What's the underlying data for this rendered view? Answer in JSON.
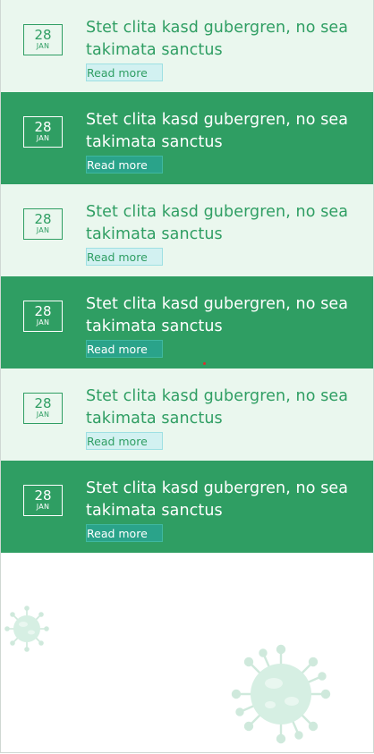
{
  "news": {
    "items": [
      {
        "day": "28",
        "month": "JAN",
        "title": "Stet clita kasd gubergren, no sea takimata sanctus",
        "link": "Read more"
      },
      {
        "day": "28",
        "month": "JAN",
        "title": "Stet clita kasd gubergren, no sea takimata sanctus",
        "link": "Read more"
      },
      {
        "day": "28",
        "month": "JAN",
        "title": "Stet clita kasd gubergren, no sea takimata sanctus",
        "link": "Read more"
      },
      {
        "day": "28",
        "month": "JAN",
        "title": "Stet clita kasd gubergren, no sea takimata sanctus",
        "link": "Read more"
      },
      {
        "day": "28",
        "month": "JAN",
        "title": "Stet clita kasd gubergren, no sea takimata sanctus",
        "link": "Read more"
      },
      {
        "day": "28",
        "month": "JAN",
        "title": "Stet clita kasd gubergren, no sea takimata sanctus",
        "link": "Read more"
      }
    ]
  },
  "decorations": {
    "icons": [
      "virus-icon",
      "virus-icon"
    ]
  },
  "colors": {
    "accent": "#2f9e63",
    "light_bg": "#eaf7ee",
    "link_bg": "#d2f1f1"
  }
}
